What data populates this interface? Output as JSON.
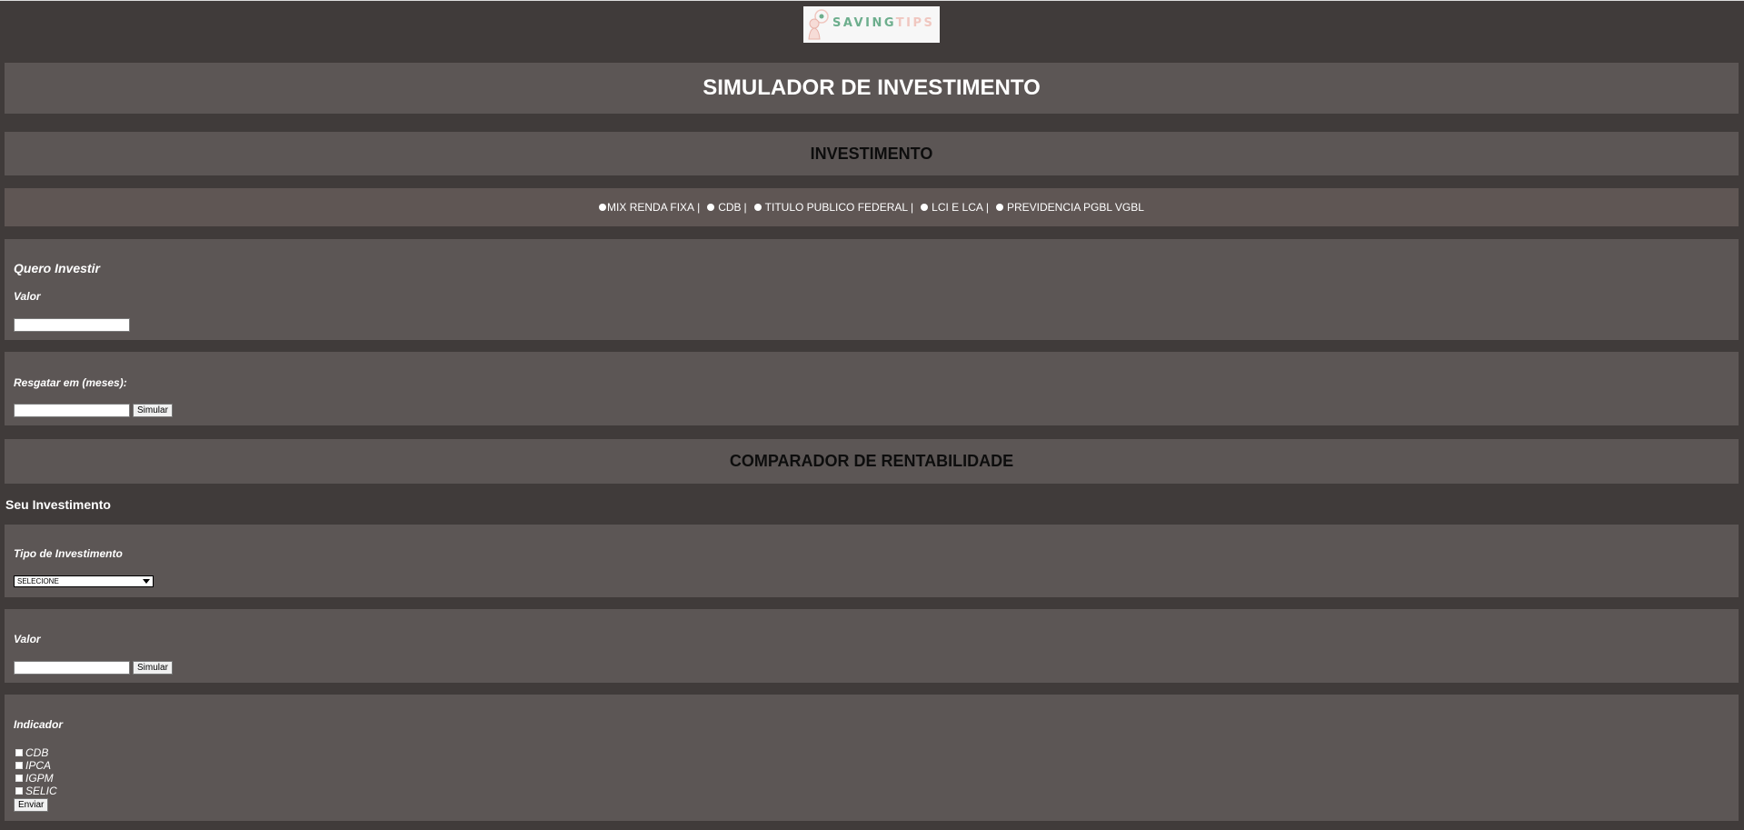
{
  "logo": {
    "text_part1": "SAVING",
    "text_part2": "TIPS",
    "icon": "person-with-thought-bubble-icon"
  },
  "header": {
    "title": "SIMULADOR DE INVESTIMENTO"
  },
  "investimento": {
    "title": "INVESTIMENTO",
    "types": [
      "MIX RENDA FIXA",
      "CDB",
      "TITULO PUBLICO FEDERAL",
      "LCI E LCA",
      "PREVIDENCIA PGBL VGBL"
    ],
    "separator": "|"
  },
  "quero_investir": {
    "heading": "Quero Investir",
    "valor_label": "Valor",
    "valor_value": ""
  },
  "resgatar": {
    "label": "Resgatar em (meses):",
    "value": "",
    "button": "Simular"
  },
  "comparador": {
    "title": "COMPARADOR DE RENTABILIDADE",
    "section_label": "Seu Investimento",
    "tipo_label": "Tipo de Investimento",
    "tipo_selected": "SELECIONE",
    "valor_label": "Valor",
    "valor_value": "",
    "valor_button": "Simular",
    "indicador_label": "Indicador",
    "indicadores": [
      "CDB",
      "IPCA",
      "IGPM",
      "SELIC"
    ],
    "submit_button": "Enviar"
  },
  "colors": {
    "page_bg": "#403b3a",
    "band_bg": "#5c5655",
    "logo_green": "#6dae8d",
    "logo_pink": "#f0c7c0"
  }
}
